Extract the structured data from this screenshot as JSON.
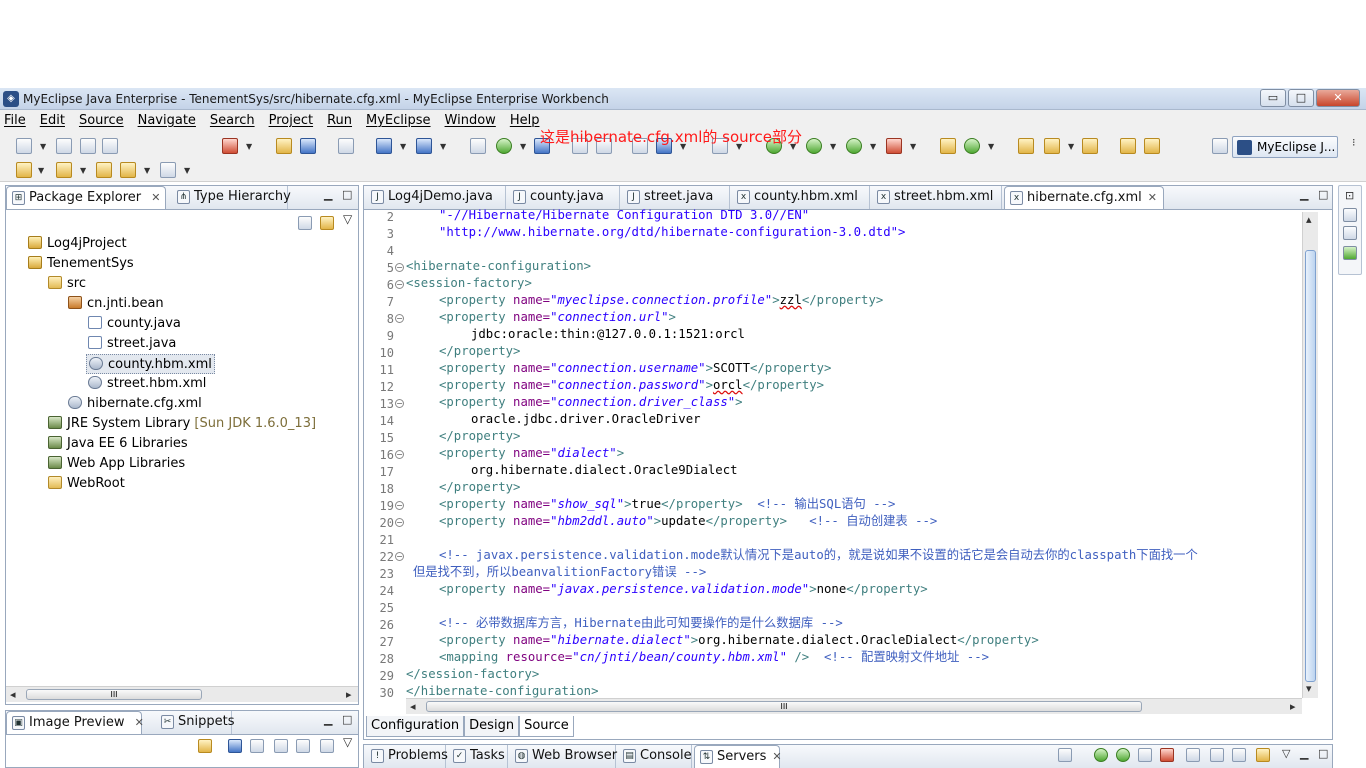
{
  "window": {
    "title": "MyEclipse Java Enterprise - TenementSys/src/hibernate.cfg.xml - MyEclipse Enterprise Workbench",
    "minimize": "▭",
    "maximize": "□",
    "close": "✕"
  },
  "menu": [
    "File",
    "Edit",
    "Source",
    "Navigate",
    "Search",
    "Project",
    "Run",
    "MyEclipse",
    "Window",
    "Help"
  ],
  "annotation": "这是hibernate.cfg.xml的 source部分",
  "perspective": "MyEclipse J...",
  "explorer": {
    "tabs": [
      {
        "label": "Package Explorer",
        "close": "✕"
      },
      {
        "label": "Type Hierarchy"
      }
    ],
    "tree": [
      {
        "label": "Log4jProject",
        "icon": "project-icon"
      },
      {
        "label": "TenementSys",
        "icon": "project-icon"
      },
      {
        "label": "src",
        "icon": "folder-icon"
      },
      {
        "label": "cn.jnti.bean",
        "icon": "package-icon"
      },
      {
        "label": "county.java",
        "icon": "java-file-icon"
      },
      {
        "label": "street.java",
        "icon": "java-file-icon"
      },
      {
        "label": "county.hbm.xml",
        "icon": "xml-file-icon"
      },
      {
        "label": "street.hbm.xml",
        "icon": "xml-file-icon"
      },
      {
        "label": "hibernate.cfg.xml",
        "icon": "xml-file-icon"
      },
      {
        "label": "JRE System Library",
        "suffix": "[Sun JDK 1.6.0_13]",
        "icon": "library-icon"
      },
      {
        "label": "Java EE 6 Libraries",
        "icon": "library-icon"
      },
      {
        "label": "Web App Libraries",
        "icon": "library-icon"
      },
      {
        "label": "WebRoot",
        "icon": "folder-icon"
      }
    ],
    "scroll_grip": "III"
  },
  "bottom_left": {
    "tabs": [
      {
        "label": "Image Preview",
        "close": "✕"
      },
      {
        "label": "Snippets"
      }
    ]
  },
  "editor": {
    "tabs": [
      {
        "label": "Log4jDemo.java"
      },
      {
        "label": "county.java"
      },
      {
        "label": "street.java"
      },
      {
        "label": "county.hbm.xml"
      },
      {
        "label": "street.hbm.xml"
      },
      {
        "label": "hibernate.cfg.xml",
        "close": "✕"
      }
    ],
    "bottom_tabs": [
      "Configuration",
      "Design",
      "Source"
    ],
    "scroll_grip": "III"
  },
  "code_lines": [
    {
      "n": "2",
      "fold": false
    },
    {
      "n": "3",
      "fold": false
    },
    {
      "n": "4",
      "fold": false
    },
    {
      "n": "5",
      "fold": true
    },
    {
      "n": "6",
      "fold": true
    },
    {
      "n": "7",
      "fold": false
    },
    {
      "n": "8",
      "fold": true
    },
    {
      "n": "9",
      "fold": false
    },
    {
      "n": "10",
      "fold": false
    },
    {
      "n": "11",
      "fold": false
    },
    {
      "n": "12",
      "fold": false
    },
    {
      "n": "13",
      "fold": true
    },
    {
      "n": "14",
      "fold": false
    },
    {
      "n": "15",
      "fold": false
    },
    {
      "n": "16",
      "fold": true
    },
    {
      "n": "17",
      "fold": false
    },
    {
      "n": "18",
      "fold": false
    },
    {
      "n": "19",
      "fold": true
    },
    {
      "n": "20",
      "fold": true
    },
    {
      "n": "21",
      "fold": false
    },
    {
      "n": "22",
      "fold": true
    },
    {
      "n": "23",
      "fold": false
    },
    {
      "n": "24",
      "fold": false
    },
    {
      "n": "25",
      "fold": false
    },
    {
      "n": "26",
      "fold": false
    },
    {
      "n": "27",
      "fold": false
    },
    {
      "n": "28",
      "fold": false
    },
    {
      "n": "29",
      "fold": false
    },
    {
      "n": "30",
      "fold": false
    }
  ],
  "code": {
    "l2": "\"-//Hibernate/Hibernate Configuration DTD 3.0//EN\"",
    "l3": "\"http://www.hibernate.org/dtd/hibernate-configuration-3.0.dtd\">",
    "tag_hibernate_configuration": "<hibernate-configuration>",
    "tag_session_factory": "<session-factory>",
    "prop_open": "<property",
    "attr_name": "name=",
    "prop_close": "</property>",
    "gt": ">",
    "n_profile": "\"myeclipse.connection.profile\"",
    "v_profile": "zzl",
    "n_url": "\"connection.url\"",
    "v_url": "jdbc:oracle:thin:@127.0.0.1:1521:orcl",
    "n_username": "\"connection.username\"",
    "v_username": "SCOTT",
    "n_password": "\"connection.password\"",
    "v_password": "orcl",
    "n_driver": "\"connection.driver_class\"",
    "v_driver": "oracle.jdbc.driver.OracleDriver",
    "n_dialect": "\"dialect\"",
    "v_dialect": "org.hibernate.dialect.Oracle9Dialect",
    "n_showsql": "\"show_sql\"",
    "v_showsql": "true",
    "c_showsql": "<!-- 输出SQL语句 -->",
    "n_hbm2ddl": "\"hbm2ddl.auto\"",
    "v_hbm2ddl": "update",
    "c_hbm2ddl": "<!-- 自动创建表 -->",
    "c_validation_1": "<!-- javax.persistence.validation.mode默认情况下是auto的，就是说如果不设置的话它是会自动去你的classpath下面找一个",
    "c_validation_2": "但是找不到，所以beanvalitionFactory错误 -->",
    "n_validation": "\"javax.persistence.validation.mode\"",
    "v_validation": "none",
    "c_dialect": "<!-- 必带数据库方言，Hibernate由此可知要操作的是什么数据库 -->",
    "n_hdialect": "\"hibernate.dialect\"",
    "v_hdialect": "org.hibernate.dialect.OracleDialect",
    "mapping_open": "<mapping",
    "attr_resource": "resource=",
    "v_resource": "\"cn/jnti/bean/county.hbm.xml\"",
    "mapping_close": " />",
    "c_mapping": "<!-- 配置映射文件地址 -->",
    "tag_session_factory_end": "</session-factory>",
    "tag_hibernate_configuration_end": "</hibernate-configuration>"
  },
  "console_tabs": [
    "Problems",
    "Tasks",
    "Web Browser",
    "Console",
    "Servers"
  ],
  "console_close": "✕",
  "colors": {
    "tag": "#3f7f7f",
    "attr": "#7f007f",
    "value": "#2a00ff",
    "comment": "#3f5fbf",
    "annotation": "#ff1a1a"
  }
}
